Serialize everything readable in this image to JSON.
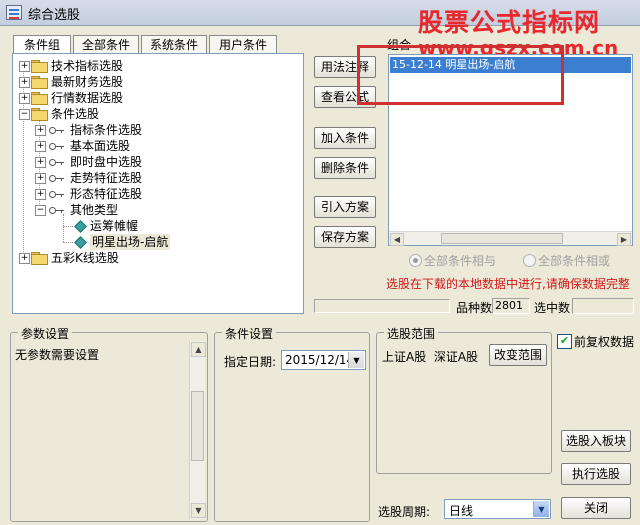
{
  "window": {
    "title": "综合选股"
  },
  "watermark": {
    "logo": "股票公式指标网",
    "url": "www.gszx.com.cn"
  },
  "tabs": [
    {
      "label": "条件组",
      "active": true
    },
    {
      "label": "全部条件",
      "active": false
    },
    {
      "label": "系统条件",
      "active": false
    },
    {
      "label": "用户条件",
      "active": false
    }
  ],
  "tree": {
    "items": [
      {
        "label": "技术指标选股",
        "type": "folder",
        "expander": "+"
      },
      {
        "label": "最新财务选股",
        "type": "folder",
        "expander": "+"
      },
      {
        "label": "行情数据选股",
        "type": "folder",
        "expander": "+"
      },
      {
        "label": "条件选股",
        "type": "folder",
        "expander": "-"
      },
      {
        "label": "指标条件选股",
        "type": "key",
        "expander": "+"
      },
      {
        "label": "基本面选股",
        "type": "key",
        "expander": "+"
      },
      {
        "label": "即时盘中选股",
        "type": "key",
        "expander": "+"
      },
      {
        "label": "走势特征选股",
        "type": "key",
        "expander": "+"
      },
      {
        "label": "形态特征选股",
        "type": "key",
        "expander": "+"
      },
      {
        "label": "其他类型",
        "type": "key",
        "expander": "-"
      },
      {
        "label": "运筹帷幄",
        "type": "leaf",
        "expander": ""
      },
      {
        "label": "明星出场-启航",
        "type": "leaf",
        "expander": ""
      },
      {
        "label": "五彩K线选股",
        "type": "folder",
        "expander": "+"
      }
    ]
  },
  "actions": {
    "usage_note": "用法注释",
    "view_formula": "查看公式",
    "add_condition": "加入条件",
    "delete_condition": "删除条件",
    "import_scheme": "引入方案",
    "save_scheme": "保存方案"
  },
  "combo": {
    "label": "组合",
    "items": [
      "15-12-14 明星出场-启航"
    ],
    "and_label": "全部条件相与",
    "or_label": "全部条件相或",
    "and_selected": true,
    "warning": "选股在下载的本地数据中进行,请确保数据完整"
  },
  "stats": {
    "count_label": "品种数",
    "count_value": "2801",
    "selected_label": "选中数",
    "selected_value": ""
  },
  "params": {
    "title": "参数设置",
    "text": "无参数需要设置"
  },
  "condition_settings": {
    "title": "条件设置",
    "date_label": "指定日期:",
    "date_value": "2015/12/14"
  },
  "range": {
    "title": "选股范围",
    "markets": "上证A股  深证A股",
    "change_button": "改变范围"
  },
  "adjust": {
    "label": "前复权数据",
    "checked": true
  },
  "period": {
    "label": "选股周期:",
    "value": "日线"
  },
  "buttons": {
    "to_board": "选股入板块",
    "execute": "执行选股",
    "close": "关闭"
  },
  "colors": {
    "warning": "#d01818",
    "selection": "#3c7fd0",
    "watermark": "#e8282d",
    "annotation_box": "#d03030"
  }
}
